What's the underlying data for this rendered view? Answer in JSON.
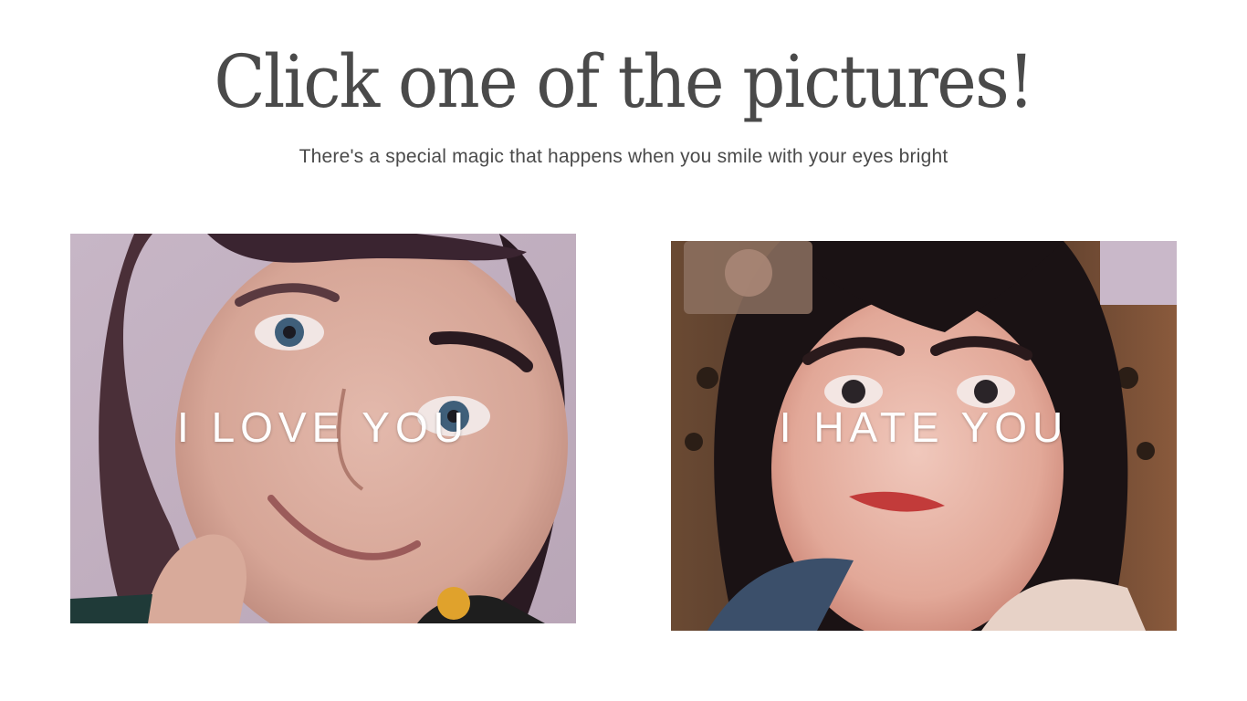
{
  "heading": {
    "title": "Click one of the pictures!",
    "subtitle": "There's a special magic that happens when you smile with your eyes bright"
  },
  "cards": [
    {
      "caption": "I LOVE YOU",
      "image_alt": "smiling-girl-photo"
    },
    {
      "caption": "I HATE YOU",
      "image_alt": "frowning-girl-photo"
    }
  ],
  "colors": {
    "heading_text": "#4a4a4a",
    "caption_text": "#ffffff",
    "background": "#ffffff"
  }
}
